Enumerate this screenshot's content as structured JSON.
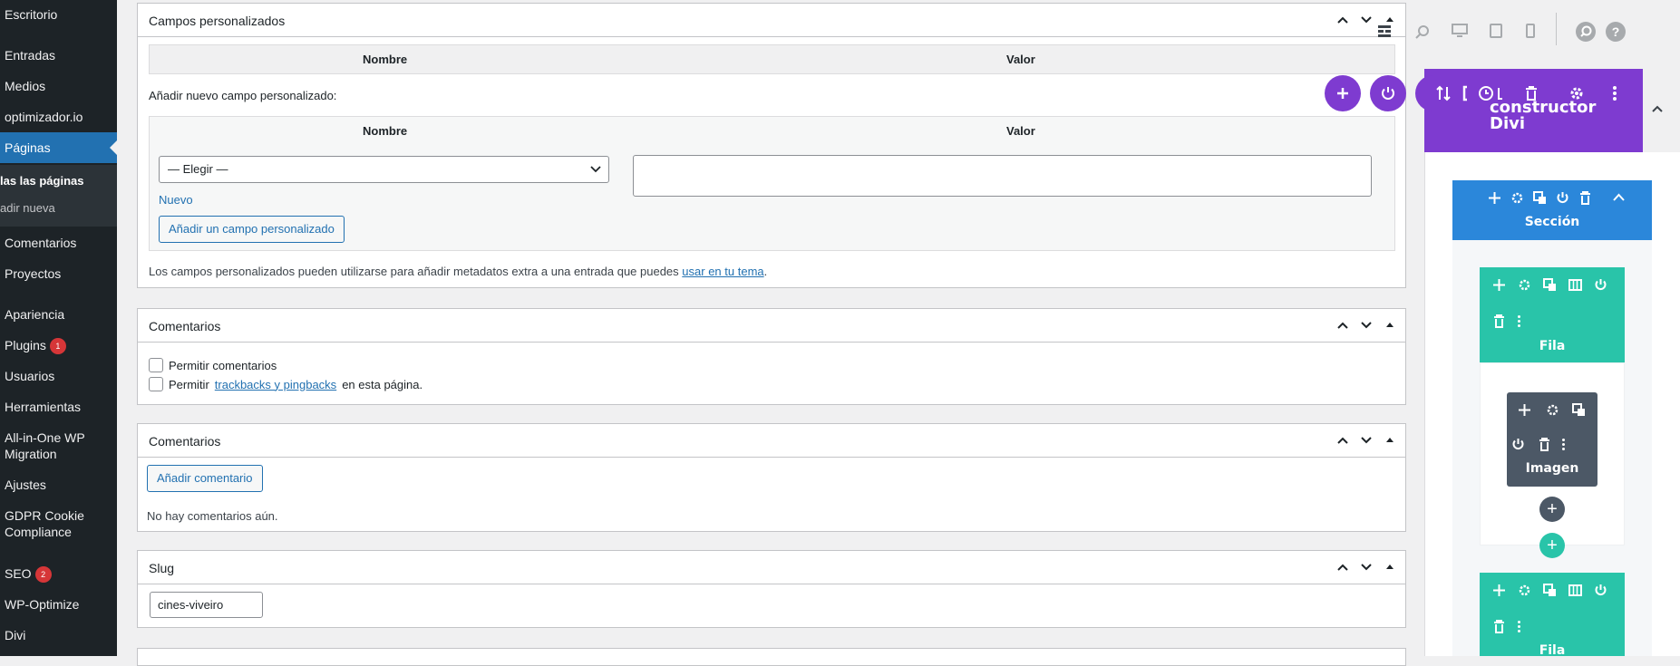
{
  "sidebar": {
    "items": [
      {
        "label": "Escritorio"
      },
      {
        "label": "Entradas"
      },
      {
        "label": "Medios"
      },
      {
        "label": "optimizador.io"
      },
      {
        "label": "Páginas"
      },
      {
        "label": "Comentarios"
      },
      {
        "label": "Proyectos"
      },
      {
        "label": "Apariencia"
      },
      {
        "label": "Plugins",
        "badge": "1"
      },
      {
        "label": "Usuarios"
      },
      {
        "label": "Herramientas"
      },
      {
        "label": "All-in-One WP Migration"
      },
      {
        "label": "Ajustes"
      },
      {
        "label": "GDPR Cookie Compliance"
      },
      {
        "label": "SEO",
        "badge": "2"
      },
      {
        "label": "WP-Optimize"
      },
      {
        "label": "Divi"
      }
    ],
    "submenu": [
      {
        "label": "las las páginas"
      },
      {
        "label": "adir nueva"
      }
    ]
  },
  "custom_fields": {
    "title": "Campos personalizados",
    "col_name": "Nombre",
    "col_value": "Valor",
    "add_label": "Añadir nuevo campo personalizado:",
    "select_value": "— Elegir —",
    "new_link": "Nuevo",
    "add_button": "Añadir un campo personalizado",
    "description": "Los campos personalizados pueden utilizarse para añadir metadatos extra a una entrada que puedes",
    "description_link": "usar en tu tema",
    "description_end": "."
  },
  "discussion": {
    "title": "Comentarios",
    "allow_comments": "Permitir comentarios",
    "allow_trackbacks_pre": "Permitir",
    "allow_trackbacks_link": "trackbacks y pingbacks",
    "allow_trackbacks_post": "en esta página."
  },
  "comments": {
    "title": "Comentarios",
    "add_button": "Añadir comentario",
    "empty": "No hay comentarios aún."
  },
  "slug": {
    "title": "Slug",
    "value": "cines-viveiro"
  },
  "divi": {
    "builder_title": "constructor Divi",
    "section_label": "Sección",
    "row_label": "Fila",
    "module_label": "Imagen",
    "colors": {
      "purple": "#7e3bd0",
      "section_blue": "#2b87da",
      "row_green": "#29c4a9",
      "module_gray": "#4c5866"
    }
  }
}
